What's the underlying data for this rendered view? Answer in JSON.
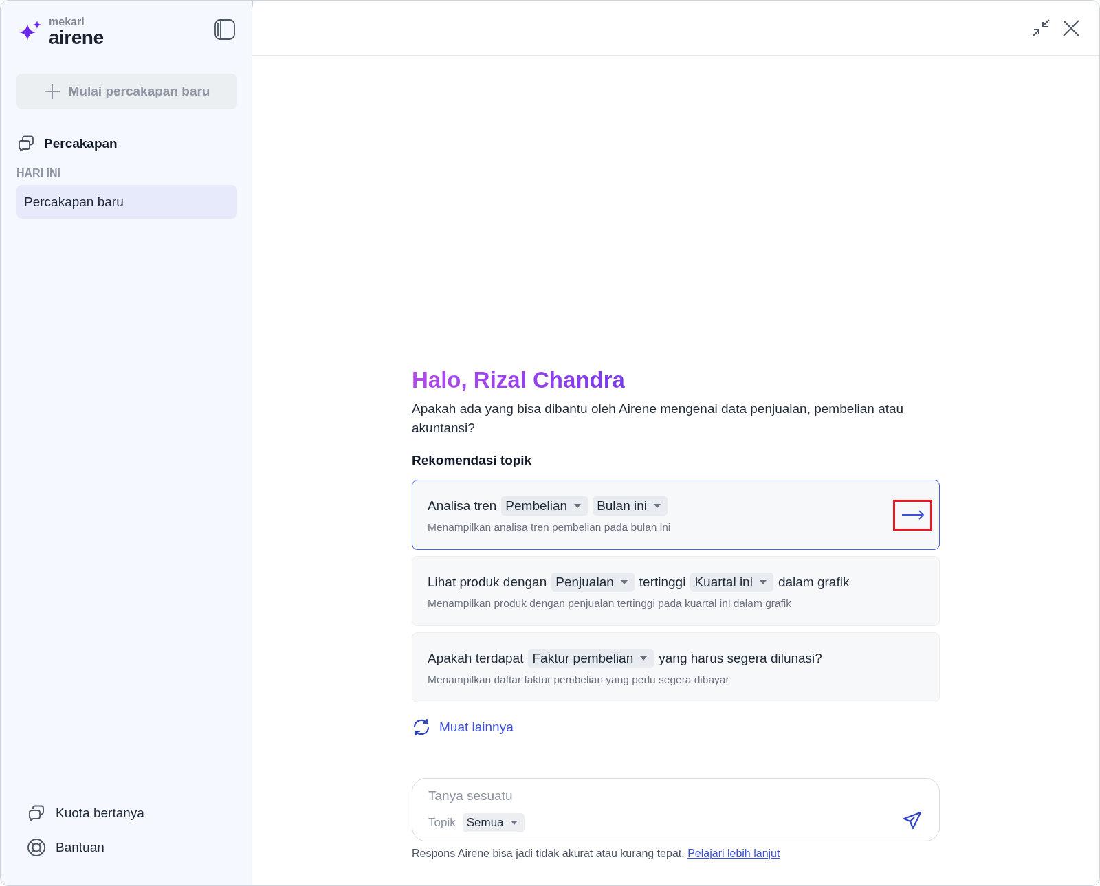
{
  "sidebar": {
    "brand": {
      "company": "mekari",
      "product": "airene"
    },
    "new_chat_button": "Mulai percakapan baru",
    "section_title": "Percakapan",
    "group_label": "HARI INI",
    "conversations": [
      {
        "label": "Percakapan baru",
        "selected": true
      }
    ],
    "footer_items": [
      {
        "kind": "quota",
        "label": "Kuota bertanya"
      },
      {
        "kind": "help",
        "label": "Bantuan"
      }
    ]
  },
  "greeting": {
    "title": "Halo, Rizal Chandra",
    "subtitle": "Apakah ada yang bisa dibantu oleh Airene mengenai data penjualan, pembelian atau akuntansi?"
  },
  "recommendations": {
    "title": "Rekomendasi topik",
    "topics": [
      {
        "selected": true,
        "highlighted": true,
        "parts": [
          {
            "kind": "text",
            "text": "Analisa tren"
          },
          {
            "kind": "dropdown",
            "text": "Pembelian"
          },
          {
            "kind": "dropdown",
            "text": "Bulan ini"
          }
        ],
        "description": "Menampilkan analisa tren pembelian pada bulan ini"
      },
      {
        "selected": false,
        "highlighted": false,
        "parts": [
          {
            "kind": "text",
            "text": "Lihat produk dengan"
          },
          {
            "kind": "dropdown",
            "text": "Penjualan"
          },
          {
            "kind": "text",
            "text": "tertinggi"
          },
          {
            "kind": "dropdown",
            "text": "Kuartal ini"
          },
          {
            "kind": "text",
            "text": "dalam grafik"
          }
        ],
        "description": "Menampilkan produk dengan penjualan tertinggi pada kuartal ini dalam grafik"
      },
      {
        "selected": false,
        "highlighted": false,
        "parts": [
          {
            "kind": "text",
            "text": "Apakah terdapat"
          },
          {
            "kind": "dropdown",
            "text": "Faktur pembelian"
          },
          {
            "kind": "text",
            "text": "yang harus segera dilunasi?"
          }
        ],
        "description": "Menampilkan daftar faktur pembelian yang perlu segera dibayar"
      }
    ],
    "load_more": "Muat lainnya"
  },
  "composer": {
    "placeholder": "Tanya sesuatu",
    "topic_label": "Topik",
    "topic_value": "Semua"
  },
  "disclaimer": {
    "text": "Respons Airene bisa jadi tidak akurat atau kurang tepat.",
    "link": "Pelajari lebih lanjut"
  }
}
